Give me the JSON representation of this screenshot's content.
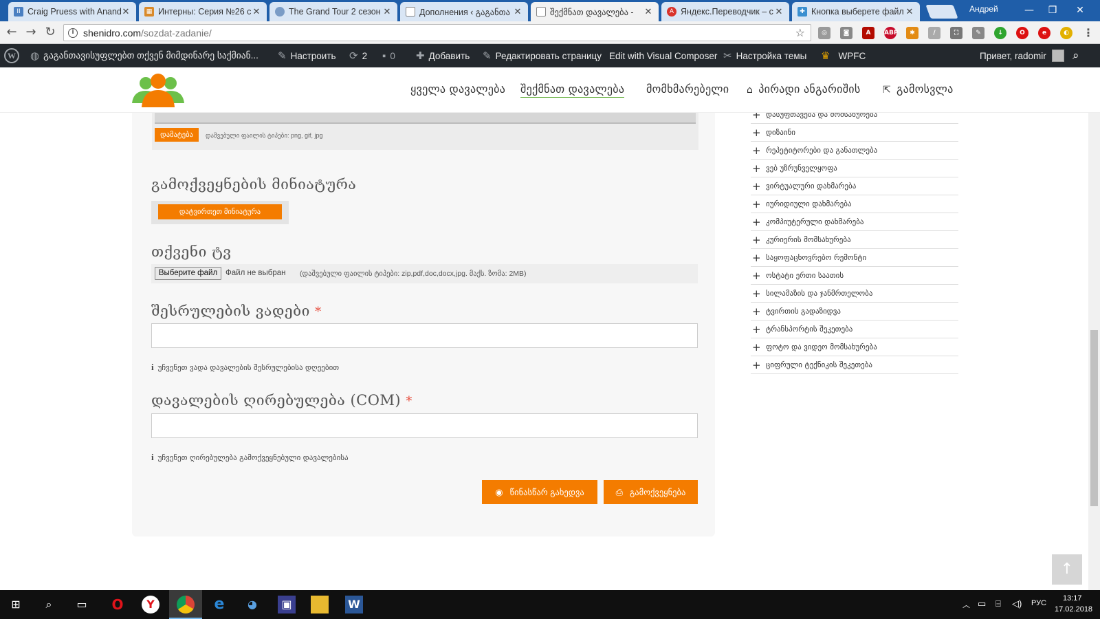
{
  "browser": {
    "tabs": [
      {
        "title": "Craig Pruess with Anand",
        "icon_color": "#4a7fc1"
      },
      {
        "title": "Интерны: Серия №26 с",
        "icon_color": "#d98a2b"
      },
      {
        "title": "The Grand Tour 2 сезон",
        "icon_color": "#7a9cc6"
      },
      {
        "title": "Дополнения ‹ გაგანთა",
        "icon_color": "#888888"
      },
      {
        "title": "შექმნათ დავალება -",
        "icon_color": "#888888"
      },
      {
        "title": "Яндекс.Переводчик – с",
        "icon_color": "#d9332b"
      },
      {
        "title": "Кнопка выберете файл",
        "icon_color": "#3a8fd0"
      }
    ],
    "profile_name": "Андрей",
    "url_host": "shenidro.com",
    "url_path": "/sozdat-zadanie/"
  },
  "adminbar": {
    "site_name": "გაგანთავისუფლებთ თქვენ მიმდინარე საქმიან...",
    "customize": "Настроить",
    "updates_count": "2",
    "comments_count": "0",
    "add_new": "Добавить",
    "edit_page": "Редактировать страницу",
    "visual_composer": "Edit with Visual Composer",
    "theme_settings": "Настройка темы",
    "wpfc": "WPFC",
    "greeting": "Привет, radomir"
  },
  "nav": {
    "all_tasks": "ყველა დავალება",
    "create_task": "შექმნათ დავალება",
    "user": "მომხმარებელი",
    "account": "პირადი ანგარიშის",
    "logout": "გამოსვლა"
  },
  "form": {
    "upload_button": "დამატება",
    "upload_hint": "დაშვებული ფაილის ტიპები: png, gif, jpg",
    "thumbnail_label": "გამოქვეყნების მინიატურა",
    "thumbnail_button": "დატვირთეთ მინიატურა",
    "resume_label": "თქვენი ტვ",
    "file_button": "Выберите файл",
    "file_status": "Файл не выбран",
    "file_hint": "(დაშვებული ფაილის ტიპები: zip,pdf,doc,docx,jpg. მაქს. ზომა: 2MB)",
    "deadline_label": "შესრულების ვადები",
    "deadline_required": "*",
    "deadline_value": "",
    "deadline_info": "უჩვენეთ ვადა დავალების შესრულებისა დღეებით",
    "price_label": "დავალების ღირებულება (COM)",
    "price_required": "*",
    "price_value": "",
    "price_info": "უჩვენეთ ღირებულება გამოქვეყნებული დავალებისა",
    "preview_button": "წინასწარ გახედვა",
    "publish_button": "გამოქვეყნება"
  },
  "categories": [
    "დასუფთავება და მომსახურება",
    "დიზაინი",
    "რეპეტიტორები და განათლება",
    "ვებ უზრუნველყოფა",
    "ვირტუალური დახმარება",
    "იურიდიული დახმარება",
    "კომპიუტერული დახმარება",
    "კურიერის მომსახურება",
    "საყოფაცხოვრებო რემონტი",
    "ოსტატი ერთი საათის",
    "სილამაზის და ჯანმრთელობა",
    "ტვირთის გადაზიდვა",
    "ტრანსპორტის შეკეთება",
    "ფოტო და ვიდეო მომსახურება",
    "ციფრული ტექნიკის შეკეთება"
  ],
  "taskbar": {
    "language": "РУС",
    "time": "13:17",
    "date": "17.02.2018"
  },
  "colors": {
    "accent": "#f47c00",
    "nav_underline": "#5aab2e",
    "adminbar": "#23282d",
    "tabstrip": "#1f5ea9"
  }
}
